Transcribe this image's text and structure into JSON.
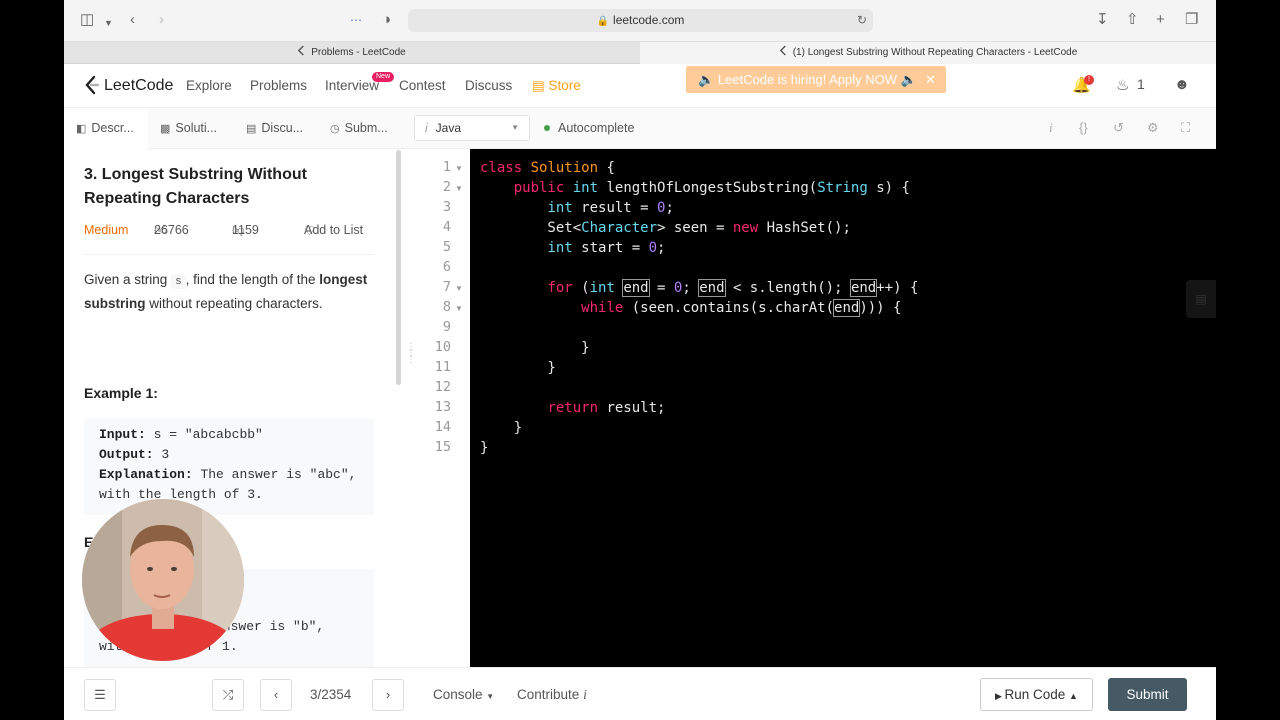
{
  "browser": {
    "url": "leetcode.com",
    "tabs": [
      {
        "title": "Problems - LeetCode"
      },
      {
        "title": "(1) Longest Substring Without Repeating Characters - LeetCode"
      }
    ]
  },
  "nav": {
    "logo": "LeetCode",
    "items": [
      "Explore",
      "Problems",
      "Interview",
      "Contest",
      "Discuss",
      "Store"
    ],
    "new_badge": "New",
    "hiring_banner": "LeetCode is hiring! Apply NOW",
    "notification_count": "!",
    "streak_count": "1",
    "colors": {
      "accent": "#ffa116",
      "banner": "#ffcc99"
    }
  },
  "panel_tabs": [
    "Descr...",
    "Soluti...",
    "Discu...",
    "Subm..."
  ],
  "editor_bar": {
    "language": "Java",
    "autocomplete": "Autocomplete"
  },
  "problem": {
    "title": "3. Longest Substring Without Repeating Characters",
    "difficulty": "Medium",
    "likes": "26766",
    "dislikes": "1159",
    "add_to_list": "Add to List",
    "statement_prefix": "Given a string",
    "statement_var": "s",
    "statement_mid": ", find the length of the",
    "statement_bold": "longest substring",
    "statement_suffix": "without repeating characters.",
    "example1": {
      "heading": "Example 1:",
      "input_label": "Input:",
      "input_value": "s = \"abcabcbb\"",
      "output_label": "Output:",
      "output_value": "3",
      "expl_label": "Explanation:",
      "expl_value": "The answer is \"abc\", with the length of 3."
    },
    "example2": {
      "heading_visible": "E",
      "partial_line1": "answer is \"b\",",
      "partial_line2_a": "wit",
      "partial_line2_b": "gth of 1."
    }
  },
  "code": {
    "line_numbers": [
      "1",
      "2",
      "3",
      "4",
      "5",
      "6",
      "7",
      "8",
      "9",
      "10",
      "11",
      "12",
      "13",
      "14",
      "15"
    ]
  },
  "bottom": {
    "page_indicator": "3/2354",
    "console": "Console",
    "contribute": "Contribute",
    "run": "Run Code",
    "submit": "Submit"
  }
}
